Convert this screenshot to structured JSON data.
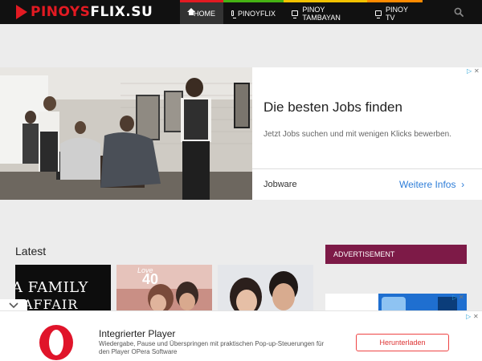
{
  "header": {
    "logo_part1": "PINOYS",
    "logo_part2": "FLIX.SU",
    "nav": [
      {
        "label": "HOME",
        "icon": "home-icon",
        "accent": "#e21a22"
      },
      {
        "label": "PINOYFLIX",
        "icon": "tv-icon",
        "accent": "#45b214"
      },
      {
        "label": "PINOY TAMBAYAN",
        "icon": "tv-icon",
        "accent": "#f2c200"
      },
      {
        "label": "PINOY TV",
        "icon": "tv-icon",
        "accent": "#ff8a00"
      }
    ],
    "search_icon": "search-icon"
  },
  "top_ad": {
    "headline": "Die besten Jobs finden",
    "subline": "Jetzt Jobs suchen und mit wenigen Klicks bewerben.",
    "brand": "Jobware",
    "cta": "Weitere Infos"
  },
  "latest": {
    "heading": "Latest",
    "thumbs": [
      {
        "title_line1": "A FAMILY",
        "title_line2": "AFFAIR"
      },
      {
        "badge": "40"
      },
      {}
    ]
  },
  "sidebar": {
    "advertisement_label": "ADVERTISEMENT"
  },
  "bottom_ad": {
    "title": "Integrierter Player",
    "description": "Wiedergabe, Pause und Überspringen mit praktischen Pop-up-Steuerungen für den Player OPera Software",
    "button": "Herunterladen"
  },
  "colors": {
    "header_bg": "#111111",
    "brand_red": "#e21a22",
    "advert_bar": "#7d1a47",
    "cta_blue": "#2e7dd8"
  }
}
